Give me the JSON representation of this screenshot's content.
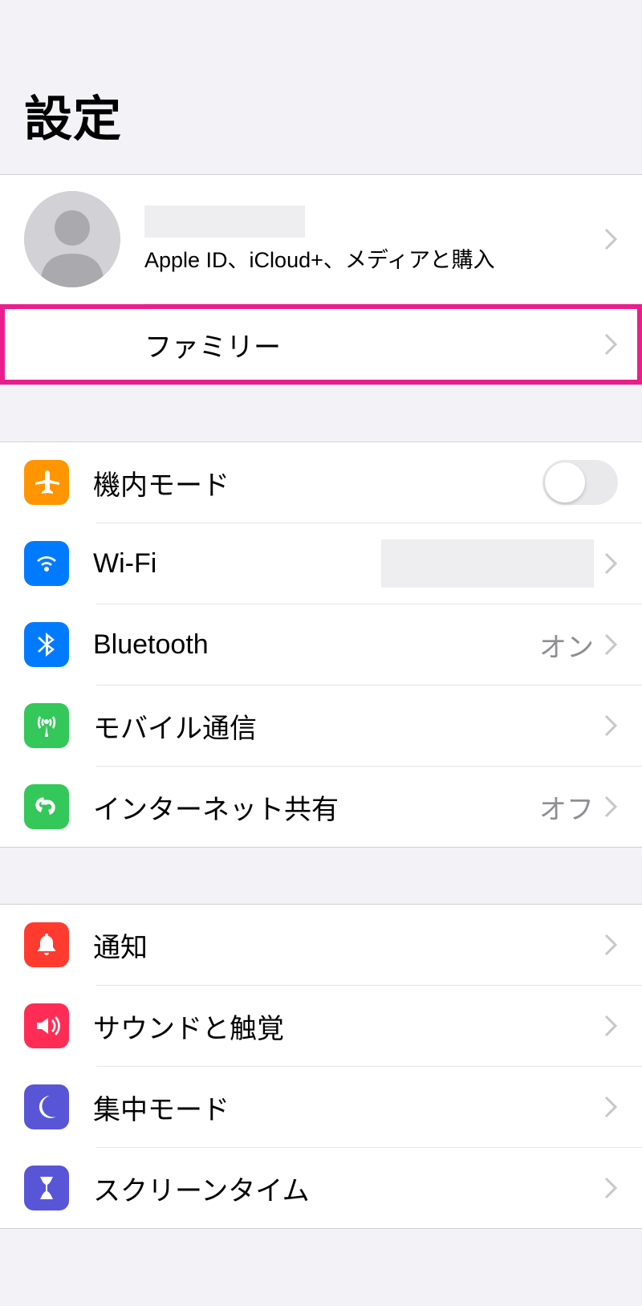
{
  "header": {
    "title": "設定"
  },
  "profile": {
    "subtitle": "Apple ID、iCloud+、メディアと購入"
  },
  "family": {
    "label": "ファミリー"
  },
  "connectivity": {
    "airplane": "機内モード",
    "wifi": "Wi-Fi",
    "bluetooth": "Bluetooth",
    "bluetooth_value": "オン",
    "cellular": "モバイル通信",
    "hotspot": "インターネット共有",
    "hotspot_value": "オフ"
  },
  "attention": {
    "notifications": "通知",
    "sounds": "サウンドと触覚",
    "focus": "集中モード",
    "screentime": "スクリーンタイム"
  },
  "colors": {
    "orange": "#ff9500",
    "blue": "#007aff",
    "green": "#34c759",
    "red": "#ff3b30",
    "pink": "#ff2d55",
    "indigo": "#5856d6"
  }
}
